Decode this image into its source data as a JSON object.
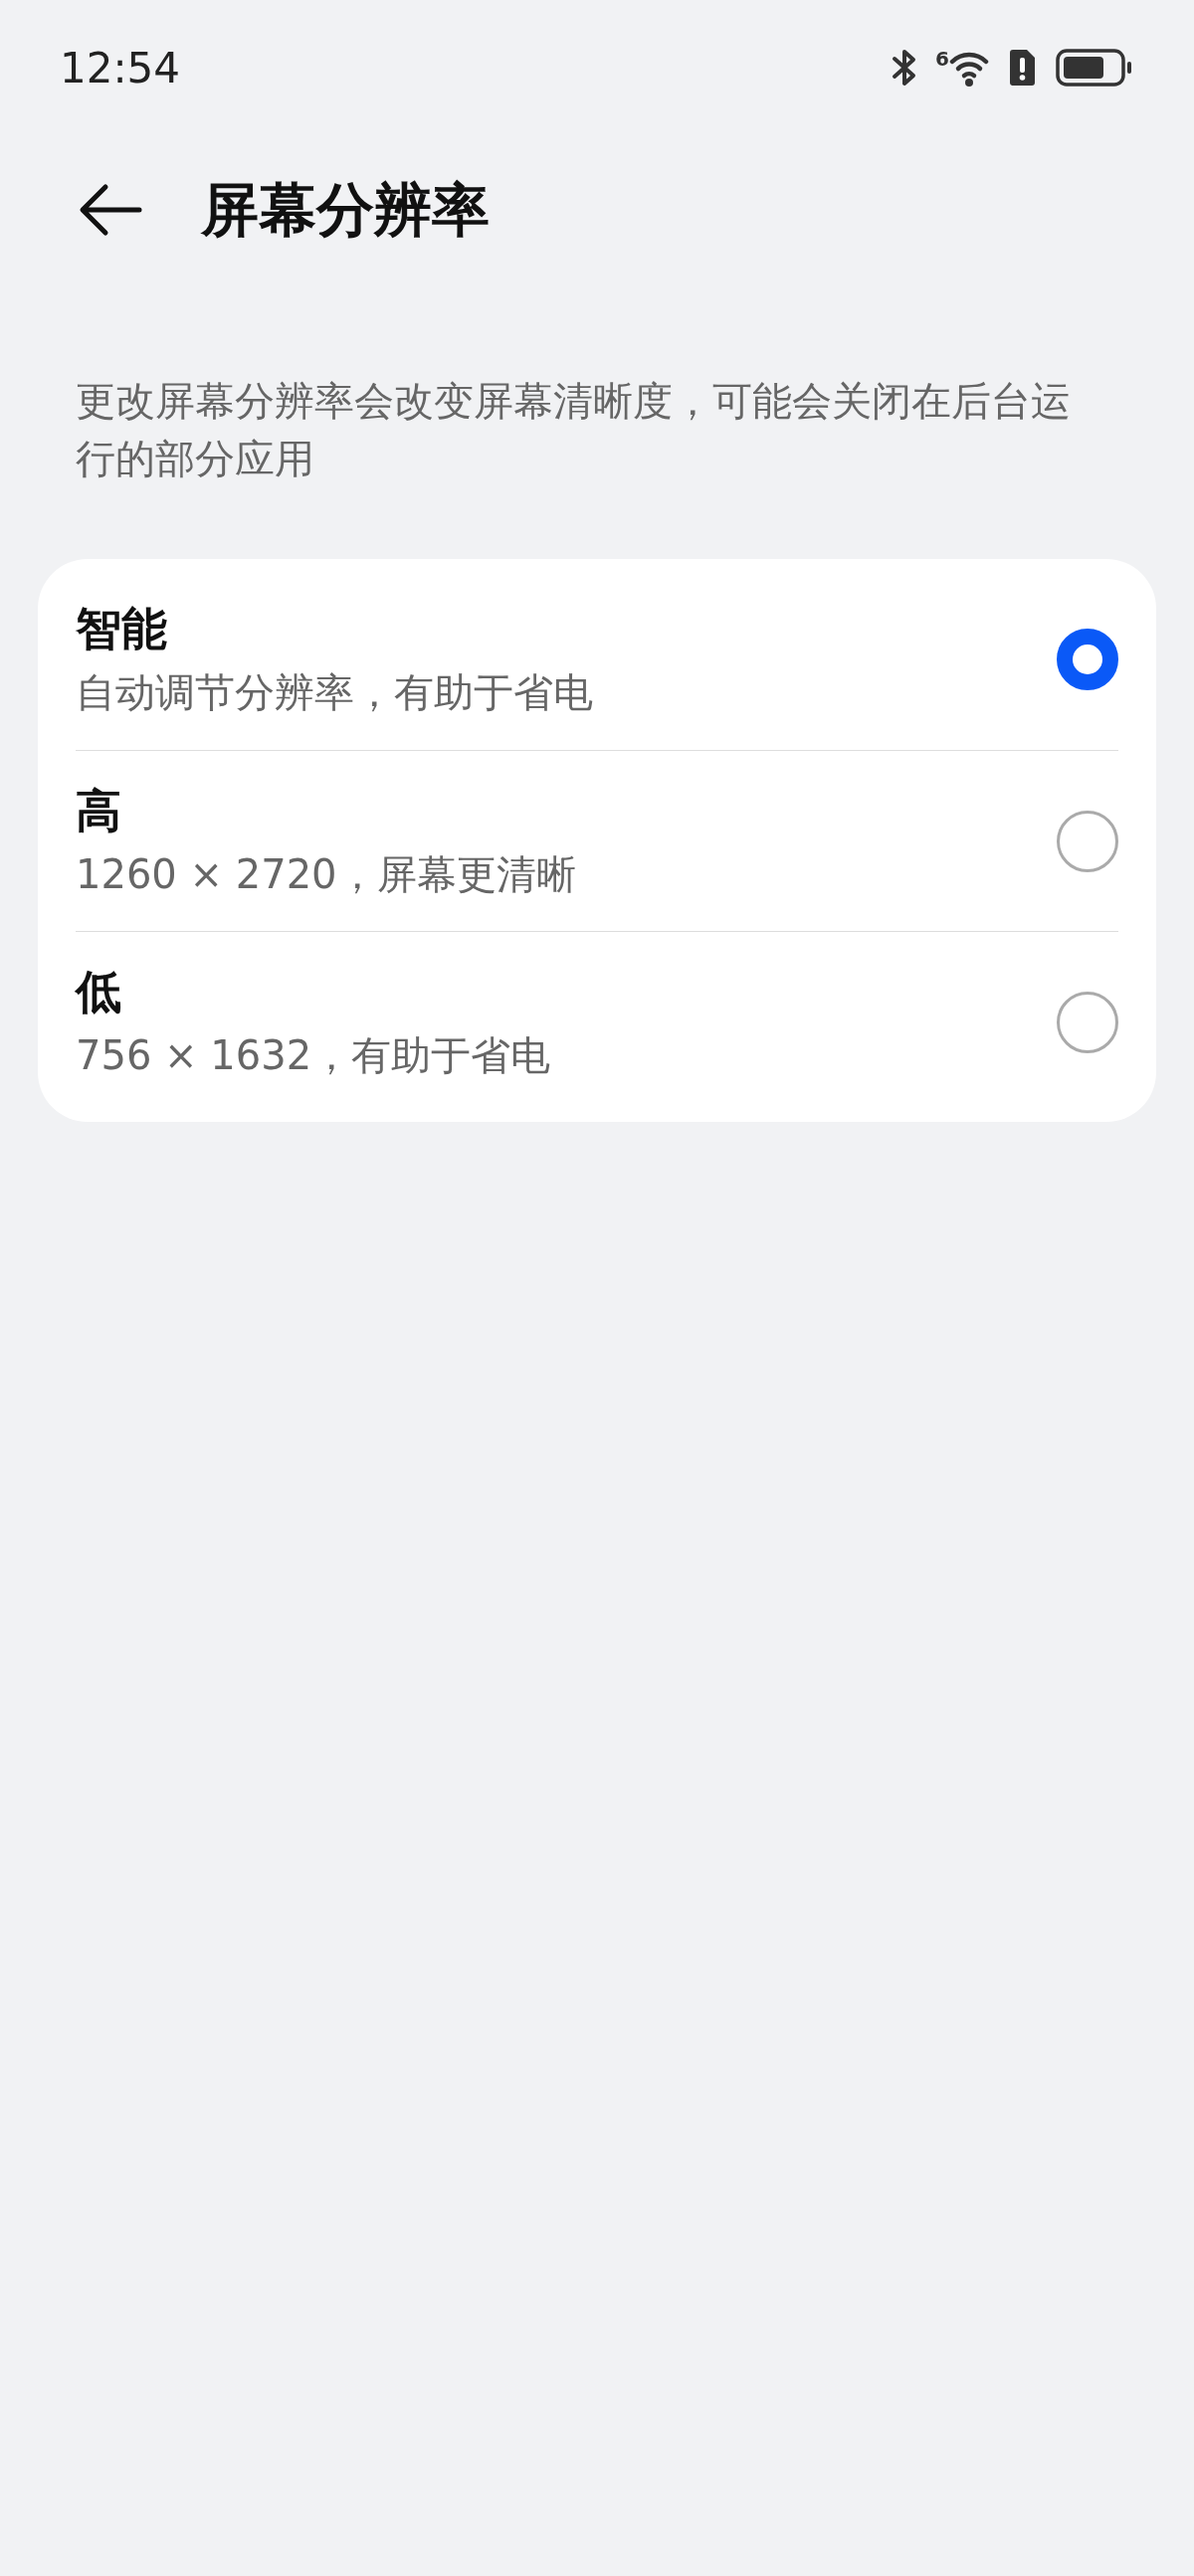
{
  "status_bar": {
    "time": "12:54",
    "wifi_badge": "6"
  },
  "header": {
    "title": "屏幕分辨率"
  },
  "description": "更改屏幕分辨率会改变屏幕清晰度，可能会关闭在后台运行的部分应用",
  "options": [
    {
      "title": "智能",
      "subtitle": "自动调节分辨率，有助于省电",
      "selected": true
    },
    {
      "title": "高",
      "subtitle": "1260 × 2720，屏幕更清晰",
      "selected": false
    },
    {
      "title": "低",
      "subtitle": "756 × 1632，有助于省电",
      "selected": false
    }
  ]
}
